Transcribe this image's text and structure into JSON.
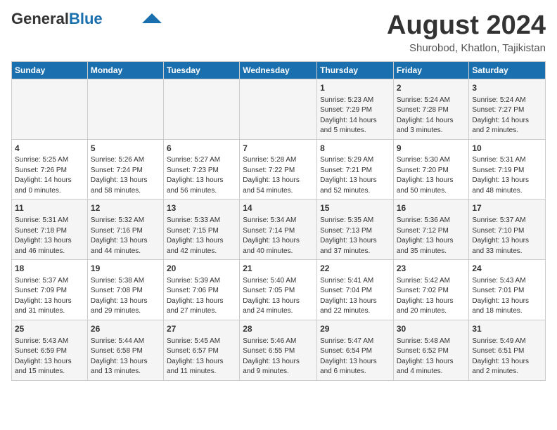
{
  "header": {
    "logo_general": "General",
    "logo_blue": "Blue",
    "month_year": "August 2024",
    "location": "Shurobod, Khatlon, Tajikistan"
  },
  "days_of_week": [
    "Sunday",
    "Monday",
    "Tuesday",
    "Wednesday",
    "Thursday",
    "Friday",
    "Saturday"
  ],
  "weeks": [
    {
      "days": [
        {
          "num": "",
          "info": ""
        },
        {
          "num": "",
          "info": ""
        },
        {
          "num": "",
          "info": ""
        },
        {
          "num": "",
          "info": ""
        },
        {
          "num": "1",
          "info": "Sunrise: 5:23 AM\nSunset: 7:29 PM\nDaylight: 14 hours\nand 5 minutes."
        },
        {
          "num": "2",
          "info": "Sunrise: 5:24 AM\nSunset: 7:28 PM\nDaylight: 14 hours\nand 3 minutes."
        },
        {
          "num": "3",
          "info": "Sunrise: 5:24 AM\nSunset: 7:27 PM\nDaylight: 14 hours\nand 2 minutes."
        }
      ]
    },
    {
      "days": [
        {
          "num": "4",
          "info": "Sunrise: 5:25 AM\nSunset: 7:26 PM\nDaylight: 14 hours\nand 0 minutes."
        },
        {
          "num": "5",
          "info": "Sunrise: 5:26 AM\nSunset: 7:24 PM\nDaylight: 13 hours\nand 58 minutes."
        },
        {
          "num": "6",
          "info": "Sunrise: 5:27 AM\nSunset: 7:23 PM\nDaylight: 13 hours\nand 56 minutes."
        },
        {
          "num": "7",
          "info": "Sunrise: 5:28 AM\nSunset: 7:22 PM\nDaylight: 13 hours\nand 54 minutes."
        },
        {
          "num": "8",
          "info": "Sunrise: 5:29 AM\nSunset: 7:21 PM\nDaylight: 13 hours\nand 52 minutes."
        },
        {
          "num": "9",
          "info": "Sunrise: 5:30 AM\nSunset: 7:20 PM\nDaylight: 13 hours\nand 50 minutes."
        },
        {
          "num": "10",
          "info": "Sunrise: 5:31 AM\nSunset: 7:19 PM\nDaylight: 13 hours\nand 48 minutes."
        }
      ]
    },
    {
      "days": [
        {
          "num": "11",
          "info": "Sunrise: 5:31 AM\nSunset: 7:18 PM\nDaylight: 13 hours\nand 46 minutes."
        },
        {
          "num": "12",
          "info": "Sunrise: 5:32 AM\nSunset: 7:16 PM\nDaylight: 13 hours\nand 44 minutes."
        },
        {
          "num": "13",
          "info": "Sunrise: 5:33 AM\nSunset: 7:15 PM\nDaylight: 13 hours\nand 42 minutes."
        },
        {
          "num": "14",
          "info": "Sunrise: 5:34 AM\nSunset: 7:14 PM\nDaylight: 13 hours\nand 40 minutes."
        },
        {
          "num": "15",
          "info": "Sunrise: 5:35 AM\nSunset: 7:13 PM\nDaylight: 13 hours\nand 37 minutes."
        },
        {
          "num": "16",
          "info": "Sunrise: 5:36 AM\nSunset: 7:12 PM\nDaylight: 13 hours\nand 35 minutes."
        },
        {
          "num": "17",
          "info": "Sunrise: 5:37 AM\nSunset: 7:10 PM\nDaylight: 13 hours\nand 33 minutes."
        }
      ]
    },
    {
      "days": [
        {
          "num": "18",
          "info": "Sunrise: 5:37 AM\nSunset: 7:09 PM\nDaylight: 13 hours\nand 31 minutes."
        },
        {
          "num": "19",
          "info": "Sunrise: 5:38 AM\nSunset: 7:08 PM\nDaylight: 13 hours\nand 29 minutes."
        },
        {
          "num": "20",
          "info": "Sunrise: 5:39 AM\nSunset: 7:06 PM\nDaylight: 13 hours\nand 27 minutes."
        },
        {
          "num": "21",
          "info": "Sunrise: 5:40 AM\nSunset: 7:05 PM\nDaylight: 13 hours\nand 24 minutes."
        },
        {
          "num": "22",
          "info": "Sunrise: 5:41 AM\nSunset: 7:04 PM\nDaylight: 13 hours\nand 22 minutes."
        },
        {
          "num": "23",
          "info": "Sunrise: 5:42 AM\nSunset: 7:02 PM\nDaylight: 13 hours\nand 20 minutes."
        },
        {
          "num": "24",
          "info": "Sunrise: 5:43 AM\nSunset: 7:01 PM\nDaylight: 13 hours\nand 18 minutes."
        }
      ]
    },
    {
      "days": [
        {
          "num": "25",
          "info": "Sunrise: 5:43 AM\nSunset: 6:59 PM\nDaylight: 13 hours\nand 15 minutes."
        },
        {
          "num": "26",
          "info": "Sunrise: 5:44 AM\nSunset: 6:58 PM\nDaylight: 13 hours\nand 13 minutes."
        },
        {
          "num": "27",
          "info": "Sunrise: 5:45 AM\nSunset: 6:57 PM\nDaylight: 13 hours\nand 11 minutes."
        },
        {
          "num": "28",
          "info": "Sunrise: 5:46 AM\nSunset: 6:55 PM\nDaylight: 13 hours\nand 9 minutes."
        },
        {
          "num": "29",
          "info": "Sunrise: 5:47 AM\nSunset: 6:54 PM\nDaylight: 13 hours\nand 6 minutes."
        },
        {
          "num": "30",
          "info": "Sunrise: 5:48 AM\nSunset: 6:52 PM\nDaylight: 13 hours\nand 4 minutes."
        },
        {
          "num": "31",
          "info": "Sunrise: 5:49 AM\nSunset: 6:51 PM\nDaylight: 13 hours\nand 2 minutes."
        }
      ]
    }
  ]
}
